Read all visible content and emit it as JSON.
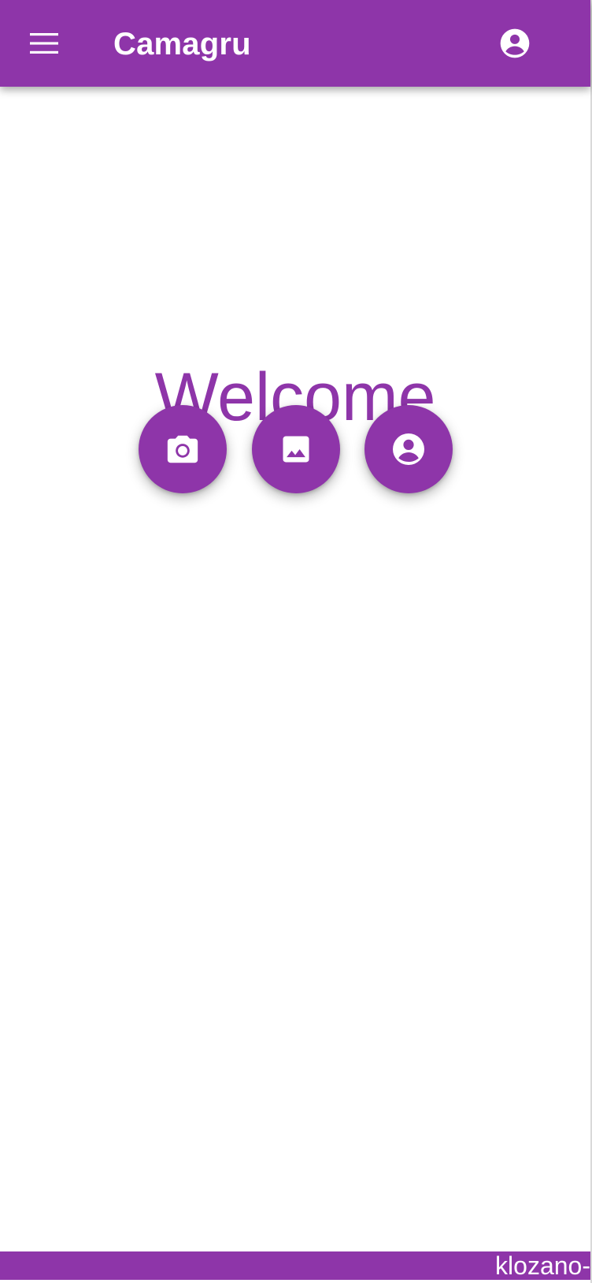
{
  "theme": {
    "primary": "#8e35a9",
    "on_primary": "#ffffff",
    "background": "#ffffff"
  },
  "appbar": {
    "title": "Camagru",
    "menu_icon": "menu-icon",
    "account_icon": "account-circle-icon"
  },
  "main": {
    "heading": "Welcome",
    "actions": [
      {
        "icon": "camera-icon"
      },
      {
        "icon": "image-icon"
      },
      {
        "icon": "account-circle-icon"
      }
    ]
  },
  "footer": {
    "text": "klozano-"
  }
}
